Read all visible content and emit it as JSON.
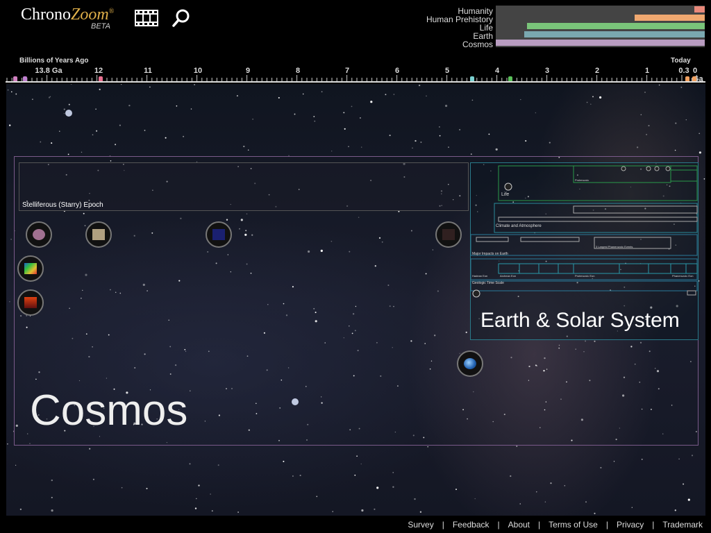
{
  "brand": {
    "chrono": "Chrono",
    "zoom": "Zoom",
    "reg": "®",
    "beta": "BETA"
  },
  "icons": {
    "tours": "film-strip-icon",
    "search": "magnifier-icon"
  },
  "nav": {
    "items": [
      {
        "label": "Humanity",
        "color": "#e8887a",
        "range_from": 0.95,
        "range_to": 1.0
      },
      {
        "label": "Human Prehistory",
        "color": "#f0a870",
        "range_from": 0.665,
        "range_to": 1.0
      },
      {
        "label": "Life",
        "color": "#7ac47a",
        "range_from": 0.15,
        "range_to": 1.0
      },
      {
        "label": "Earth",
        "color": "#7aa8b0",
        "range_from": 0.135,
        "range_to": 1.0
      },
      {
        "label": "Cosmos",
        "color": "#b89cc0",
        "range_from": 0.0,
        "range_to": 1.0
      }
    ]
  },
  "axis": {
    "title": "Billions of Years Ago",
    "today": "Today",
    "ticks": [
      "13.8 Ga",
      "12",
      "11",
      "10",
      "9",
      "8",
      "7",
      "6",
      "5",
      "4",
      "3",
      "2",
      "1",
      "0.3",
      "0 Ga"
    ],
    "markers": [
      {
        "color": "#d080c0"
      },
      {
        "color": "#c080d0"
      },
      {
        "color": "#e87090"
      },
      {
        "color": "#7ad0d0"
      },
      {
        "color": "#5ac05a"
      },
      {
        "color": "#f0a060"
      },
      {
        "color": "#f0a060"
      }
    ]
  },
  "canvas": {
    "cosmos_title": "Cosmos",
    "starry_label": "Stelliferous (Starry) Epoch",
    "earth_title": "Earth & Solar System",
    "earth_mini_labels": [
      "Life",
      "Climate and Atmosphere",
      "Major Impacts on Earth",
      "Geologic Time Scale",
      "Proterozoic",
      "3 Largest Phanerozoic Events",
      "Hadean Eon",
      "Archean Eon",
      "Proterozoic Eon",
      "Phanerozoic Eon"
    ],
    "exhibits": [
      {
        "name": "galaxy-exhibit",
        "thumb": "#a07090"
      },
      {
        "name": "nebula-exhibit",
        "thumb": "#b0a080"
      },
      {
        "name": "stars-exhibit",
        "thumb": "#2030a0"
      },
      {
        "name": "solar-exhibit",
        "thumb": "#c04020"
      },
      {
        "name": "rainbow-exhibit",
        "thumb": "#e0b030"
      },
      {
        "name": "red-exhibit",
        "thumb": "#b02020"
      },
      {
        "name": "earth-exhibit",
        "thumb": "#4070c0"
      }
    ]
  },
  "footer": {
    "links": [
      "Survey",
      "Feedback",
      "About",
      "Terms of Use",
      "Privacy",
      "Trademark"
    ]
  }
}
